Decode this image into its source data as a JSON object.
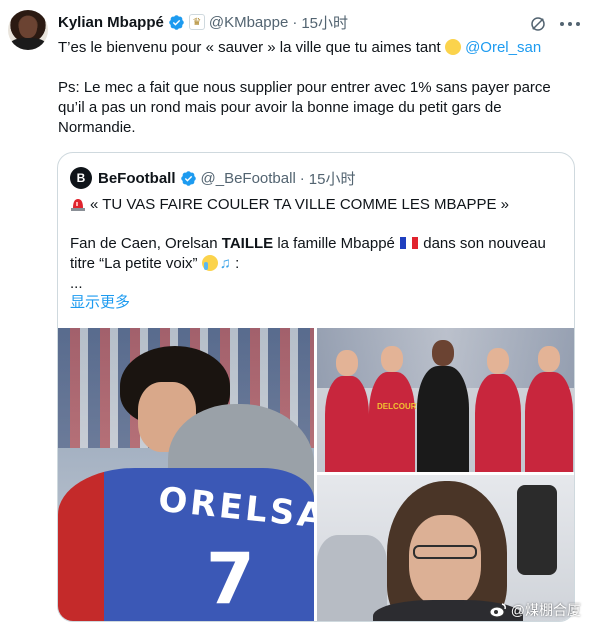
{
  "tweet": {
    "author_name": "Kylian Mbappé",
    "handle": "@KMbappe",
    "separator": "·",
    "time": "15小时",
    "text_line1": "T’es le bienvenu pour « sauver » la ville que tu aimes tant",
    "mention": "@Orel_san",
    "text_ps": "Ps: Le mec a fait que nous supplier pour entrer avec 1% sans payer parce qu’il a pas un rond mais pour avoir la bonne image du petit gars de Normandie."
  },
  "quote": {
    "logo_letter": "B",
    "author_name": "BeFootball",
    "handle": "@_BeFootball",
    "separator": "·",
    "time": "15小时",
    "headline": "« TU VAS FAIRE COULER TA VILLE COMME LES MBAPPE »",
    "text_a": "Fan de Caen, Orelsan ",
    "text_bold": "TAILLE",
    "text_b": " la famille Mbappé ",
    "text_c": " dans son nouveau titre “La petite voix” ",
    "text_d": " :",
    "ellipsis": "...",
    "show_more": "显示更多"
  },
  "media": {
    "left_jersey_text": "ORELSAN",
    "left_jersey_number": "7",
    "tr_logo_text": "DELCOURT"
  },
  "watermark": {
    "text": "@煤棚合厦"
  },
  "colors": {
    "accent": "#1d9bf0",
    "text": "#0f1419",
    "muted": "#536471",
    "border": "#cfd9de"
  },
  "icons": [
    "verified-badge-icon",
    "real-madrid-badge-icon",
    "grok-icon",
    "more-icon",
    "siren-icon",
    "france-flag-icon",
    "crying-face-icon",
    "music-note-icon",
    "weibo-icon"
  ]
}
